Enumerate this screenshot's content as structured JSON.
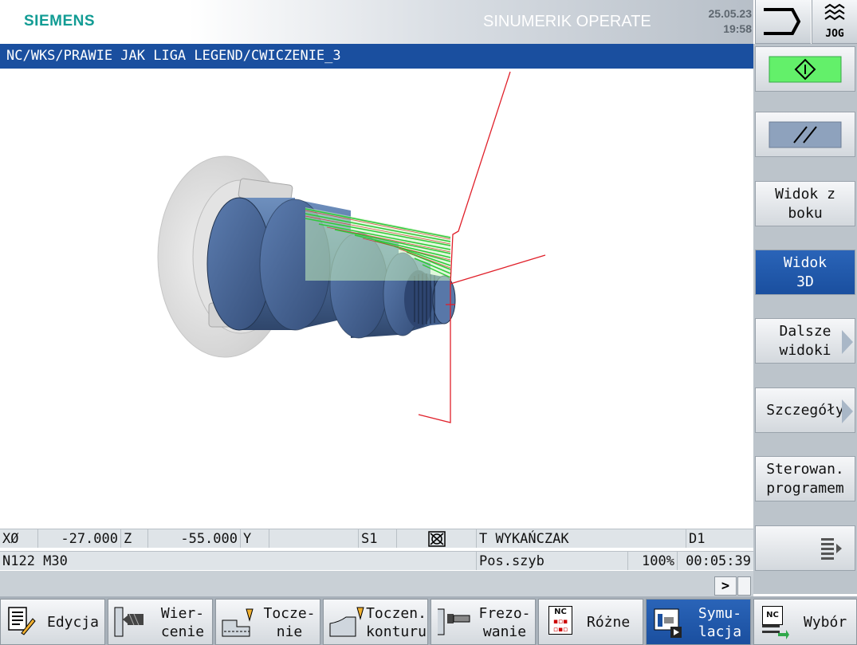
{
  "header": {
    "logo": "SIEMENS",
    "product": "SINUMERIK OPERATE",
    "date": "25.05.23",
    "time": "19:58",
    "jog_label": "JOG"
  },
  "path": "NC/WKS/PRAWIE JAK LIGA LEGEND/CWICZENIE_3",
  "status": {
    "x_label": "XØ",
    "x_value": "-27.000",
    "z_label": "Z",
    "z_value": "-55.000",
    "y_label": "Y",
    "y_value": "",
    "spindle": "S1",
    "tool": "T WYKAŃCZAK",
    "d": "D1",
    "block": "N122 M30",
    "feed_label": "Pos.szyb",
    "override": "100%",
    "runtime": "00:05:39",
    "more": ">"
  },
  "softkeys": {
    "widok_z_boku_1": "Widok z",
    "widok_z_boku_2": "boku",
    "widok_3d_1": "Widok",
    "widok_3d_2": "3D",
    "dalsze_1": "Dalsze",
    "dalsze_2": "widoki",
    "szczegoly": "Szczegóły",
    "sterowan_1": "Sterowan.",
    "sterowan_2": "programem"
  },
  "tabs": {
    "edycja": "Edycja",
    "wiercenie_1": "Wier-",
    "wiercenie_2": "cenie",
    "toczenie_1": "Tocze-",
    "toczenie_2": "nie",
    "toczen_konturu_1": "Toczen.",
    "toczen_konturu_2": "konturu",
    "frezowanie_1": "Frezo-",
    "frezowanie_2": "wanie",
    "rozne": "Różne",
    "symulacja_1": "Symu-",
    "symulacja_2": "lacja",
    "wybor": "Wybór",
    "nc_badge": "NC"
  },
  "colors": {
    "accent_blue": "#1a4f9f",
    "siemens_teal": "#129c94",
    "cycle_start_green": "#63f06a",
    "toolpath_red": "#e0202a",
    "removed_material_green": "#2fc93a"
  }
}
